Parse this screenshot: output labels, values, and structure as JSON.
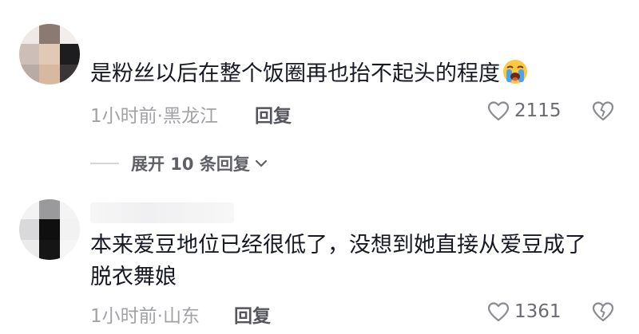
{
  "comments": [
    {
      "text": "是粉丝以后在整个饭圈再也抬不起头的程度",
      "emoji": "loudly-crying-face-icon",
      "time_location": "1小时前·黑龙江",
      "reply_label": "回复",
      "likes": "2115"
    },
    {
      "text_line1": "本来爱豆地位已经很低了，没想到她直接从爱豆成了",
      "text_line2": "脱衣舞娘",
      "time_location": "1小时前·山东",
      "reply_label": "回复",
      "likes": "1361"
    }
  ],
  "expand_replies": {
    "label": "展开 10 条回复"
  },
  "colors": {
    "text": "#161823",
    "meta": "#a1a2a6",
    "reply": "#55565d"
  }
}
